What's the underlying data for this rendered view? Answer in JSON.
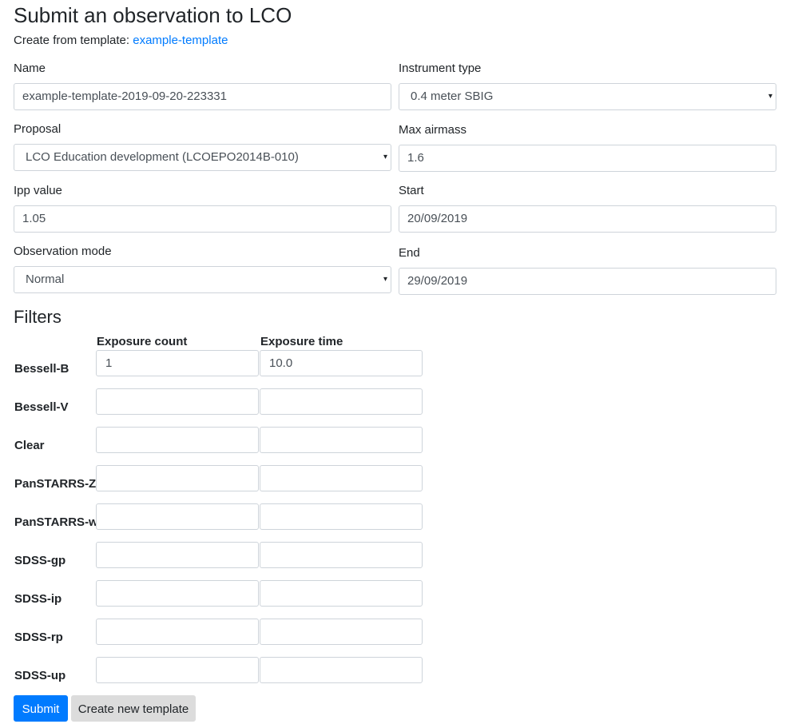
{
  "page": {
    "title": "Submit an observation to LCO",
    "template_prefix": "Create from template:",
    "template_link": "example-template"
  },
  "form": {
    "name": {
      "label": "Name",
      "value": "example-template-2019-09-20-223331"
    },
    "instrument_type": {
      "label": "Instrument type",
      "value": "0.4 meter SBIG"
    },
    "proposal": {
      "label": "Proposal",
      "value": "LCO Education development (LCOEPO2014B-010)"
    },
    "max_airmass": {
      "label": "Max airmass",
      "value": "1.6"
    },
    "ipp_value": {
      "label": "Ipp value",
      "value": "1.05"
    },
    "start": {
      "label": "Start",
      "value": "20/09/2019"
    },
    "observation_mode": {
      "label": "Observation mode",
      "value": "Normal"
    },
    "end": {
      "label": "End",
      "value": "29/09/2019"
    }
  },
  "filters": {
    "heading": "Filters",
    "columns": [
      "Exposure count",
      "Exposure time"
    ],
    "rows": [
      {
        "name": "Bessell-B",
        "count": "1",
        "time": "10.0"
      },
      {
        "name": "Bessell-V",
        "count": "",
        "time": ""
      },
      {
        "name": "Clear",
        "count": "",
        "time": ""
      },
      {
        "name": "PanSTARRS-Z",
        "count": "",
        "time": ""
      },
      {
        "name": "PanSTARRS-w",
        "count": "",
        "time": ""
      },
      {
        "name": "SDSS-gp",
        "count": "",
        "time": ""
      },
      {
        "name": "SDSS-ip",
        "count": "",
        "time": ""
      },
      {
        "name": "SDSS-rp",
        "count": "",
        "time": ""
      },
      {
        "name": "SDSS-up",
        "count": "",
        "time": ""
      }
    ]
  },
  "actions": {
    "submit": "Submit",
    "create_template": "Create new template"
  },
  "colors": {
    "primary": "#007bff",
    "secondary_button": "#dcdcdc",
    "link": "#007bff"
  }
}
